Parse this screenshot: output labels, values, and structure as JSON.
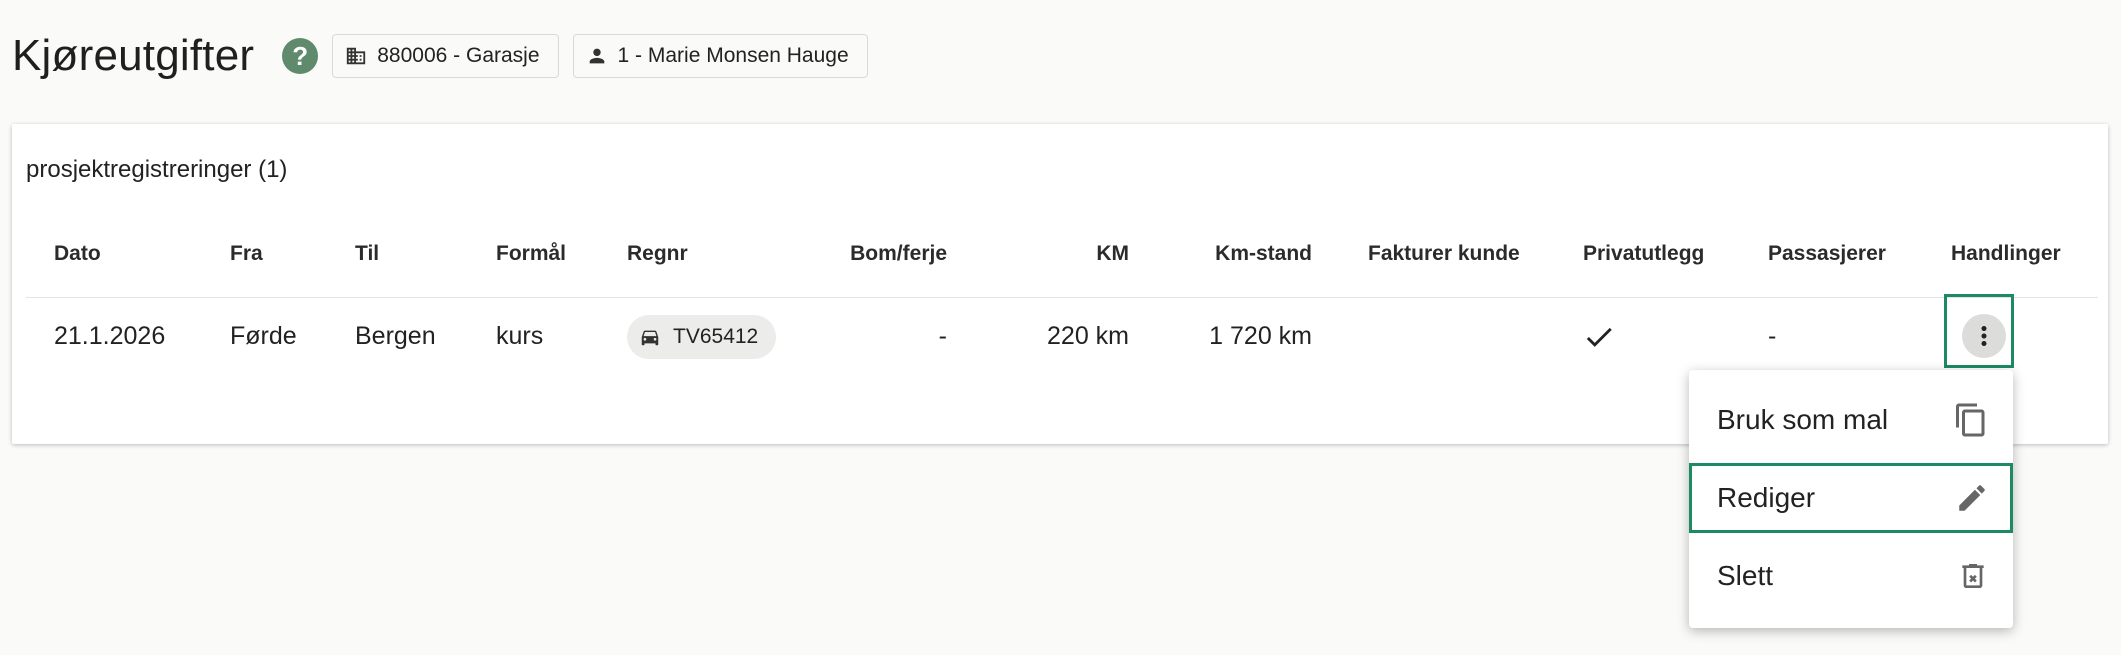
{
  "header": {
    "title": "Kjøreutgifter",
    "help_icon": "help-circle-icon",
    "department_chip": "880006 - Garasje",
    "employee_chip": "1 - Marie Monsen Hauge"
  },
  "card": {
    "title": "prosjektregistreringer (1)",
    "columns": [
      "Dato",
      "Fra",
      "Til",
      "Formål",
      "Regnr",
      "Bom/ferje",
      "KM",
      "Km-stand",
      "Fakturer kunde",
      "Privatutlegg",
      "Passasjerer",
      "Handlinger"
    ],
    "rows": [
      {
        "dato": "21.1.2026",
        "fra": "Førde",
        "til": "Bergen",
        "formal": "kurs",
        "regnr": "TV65412",
        "bom_ferje": "-",
        "km": "220 km",
        "km_stand": "1 720 km",
        "fakturer_kunde": "",
        "privatutlegg": "checked",
        "passasjerer": "-"
      }
    ]
  },
  "menu": {
    "items": [
      {
        "label": "Bruk som mal",
        "icon": "copy-icon"
      },
      {
        "label": "Rediger",
        "icon": "pencil-icon"
      },
      {
        "label": "Slett",
        "icon": "trash-icon"
      }
    ]
  },
  "colors": {
    "accent": "#1d8a63",
    "help": "#5f8a6b",
    "background": "#fafaf9"
  }
}
